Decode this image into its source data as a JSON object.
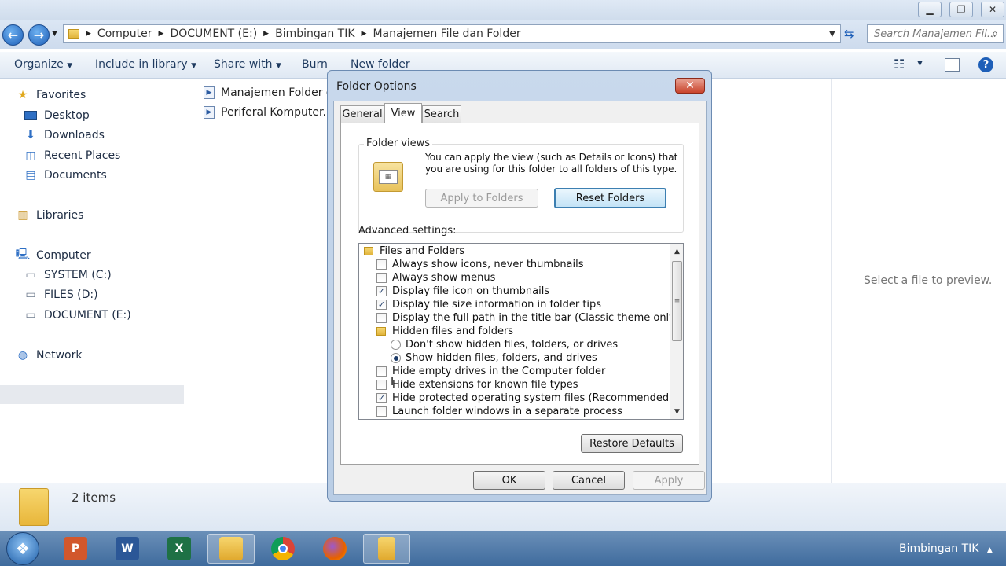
{
  "explorer": {
    "address_crumbs": [
      "Computer",
      "DOCUMENT (E:)",
      "Bimbingan TIK",
      "Manajemen File dan Folder"
    ],
    "search_placeholder": "Search Manajemen Fil...",
    "toolbar": {
      "organize": "Organize",
      "include_in_library": "Include in library",
      "share_with": "Share with",
      "burn": "Burn",
      "new_folder": "New folder"
    },
    "sidebar": {
      "favorites": "Favorites",
      "desktop": "Desktop",
      "downloads": "Downloads",
      "recent_places": "Recent Places",
      "documents": "Documents",
      "libraries": "Libraries",
      "computer": "Computer",
      "system_c": "SYSTEM (C:)",
      "files_d": "FILES (D:)",
      "document_e": "DOCUMENT (E:)",
      "network": "Network"
    },
    "files": [
      "Manajemen Folder da",
      "Periferal Komputer.mp"
    ],
    "preview_text": "Select a file to preview.",
    "status_text": "2 items"
  },
  "taskbar": {
    "tray_label": "Bimbingan TIK",
    "apps": [
      "powerpoint-icon",
      "word-icon",
      "excel-icon",
      "explorer-icon",
      "chrome-icon",
      "firefox-icon",
      "folder-options-icon"
    ]
  },
  "dialog": {
    "title": "Folder Options",
    "close_glyph": "✕",
    "tabs": [
      "General",
      "View",
      "Search"
    ],
    "active_tab": "View",
    "folder_views": {
      "label": "Folder views",
      "description": "You can apply the view (such as Details or Icons) that you are using for this folder to all folders of this type.",
      "apply_button": "Apply to Folders",
      "reset_button": "Reset Folders"
    },
    "advanced_label": "Advanced settings:",
    "advanced_items": [
      {
        "type": "folder",
        "label": "Files and Folders"
      },
      {
        "type": "checkbox",
        "checked": false,
        "label": "Always show icons, never thumbnails"
      },
      {
        "type": "checkbox",
        "checked": false,
        "label": "Always show menus"
      },
      {
        "type": "checkbox",
        "checked": true,
        "label": "Display file icon on thumbnails"
      },
      {
        "type": "checkbox",
        "checked": true,
        "label": "Display file size information in folder tips"
      },
      {
        "type": "checkbox",
        "checked": false,
        "label": "Display the full path in the title bar (Classic theme only)"
      },
      {
        "type": "subfolder",
        "label": "Hidden files and folders"
      },
      {
        "type": "radio",
        "checked": false,
        "label": "Don't show hidden files, folders, or drives"
      },
      {
        "type": "radio",
        "checked": true,
        "label": "Show hidden files, folders, and drives"
      },
      {
        "type": "checkbox",
        "checked": false,
        "label": "Hide empty drives in the Computer folder"
      },
      {
        "type": "checkbox",
        "checked": false,
        "label": "Hide extensions for known file types"
      },
      {
        "type": "checkbox",
        "checked": true,
        "label": "Hide protected operating system files (Recommended)"
      },
      {
        "type": "checkbox",
        "checked": false,
        "label": "Launch folder windows in a separate process"
      }
    ],
    "restore_defaults": "Restore Defaults",
    "ok": "OK",
    "cancel": "Cancel",
    "apply": "Apply"
  }
}
